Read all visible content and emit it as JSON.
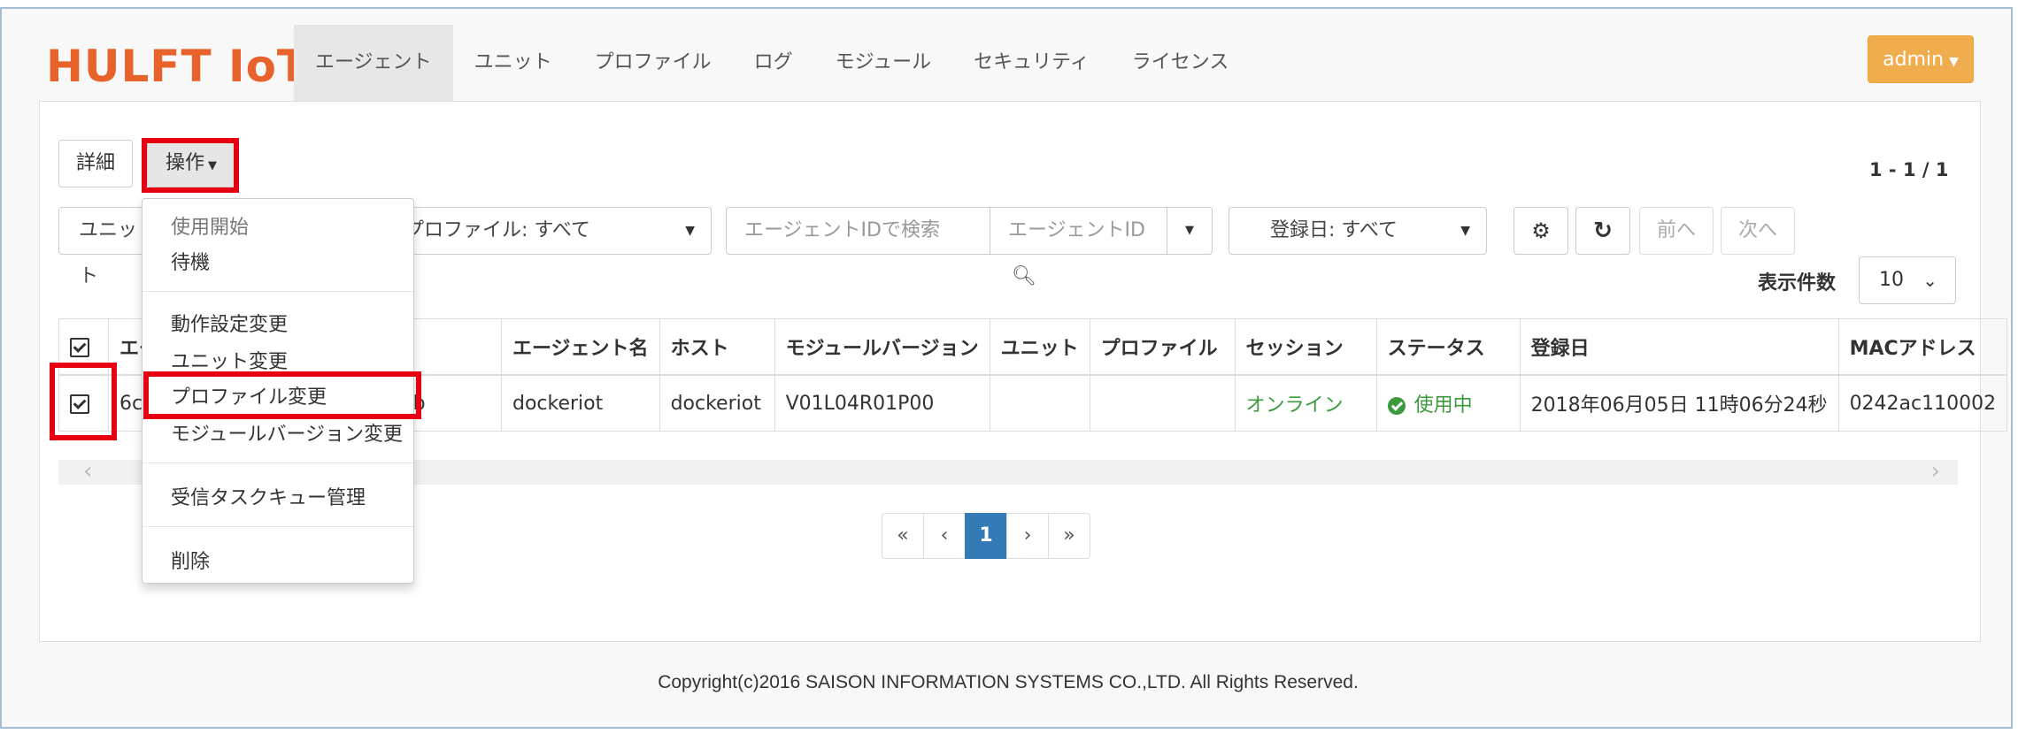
{
  "header": {
    "logo": "HULFT IoT",
    "nav": [
      "エージェント",
      "ユニット",
      "プロファイル",
      "ログ",
      "モジュール",
      "セキュリティ",
      "ライセンス"
    ],
    "admin": "admin"
  },
  "toolbar": {
    "detail_label": "詳細",
    "operation_label": "操作",
    "count": "1 - 1 / 1",
    "unit_filter": "ユニット",
    "profile_filter": "プロファイル: すべて",
    "search_placeholder": "エージェントIDで検索",
    "search_field": "エージェントID",
    "date_filter": "登録日: すべて",
    "prev": "前へ",
    "next": "次へ",
    "page_size_label": "表示件数",
    "page_size": "10"
  },
  "table": {
    "headers": [
      "エー",
      "エージェント名",
      "ホスト",
      "モジュールバージョン",
      "ユニット",
      "プロファイル",
      "セッション",
      "ステータス",
      "登録日",
      "MACアドレス"
    ],
    "row": {
      "id_start": "6c",
      "id_end": "c70adbb",
      "name": "dockeriot",
      "host": "dockeriot",
      "module_version": "V01L04R01P00",
      "unit": "",
      "profile": "",
      "session": "オンライン",
      "status": "使用中",
      "registered": "2018年06月05日 11時06分24秒",
      "mac": "0242ac110002"
    }
  },
  "pagination": {
    "first": "«",
    "prev": "‹",
    "current": "1",
    "next": "›",
    "last": "»"
  },
  "dropdown": {
    "items": [
      "使用開始",
      "待機",
      "動作設定変更",
      "ユニット変更",
      "プロファイル変更",
      "モジュールバージョン変更",
      "受信タスクキュー管理",
      "削除"
    ]
  },
  "footer": "Copyright(c)2016 SAISON INFORMATION SYSTEMS CO.,LTD. All Rights Reserved.",
  "colors": {
    "logo": "#e8622c",
    "admin": "#f0ad4e",
    "active_page": "#337ab7",
    "highlight": "#e60012",
    "online": "#3c9a3c"
  }
}
